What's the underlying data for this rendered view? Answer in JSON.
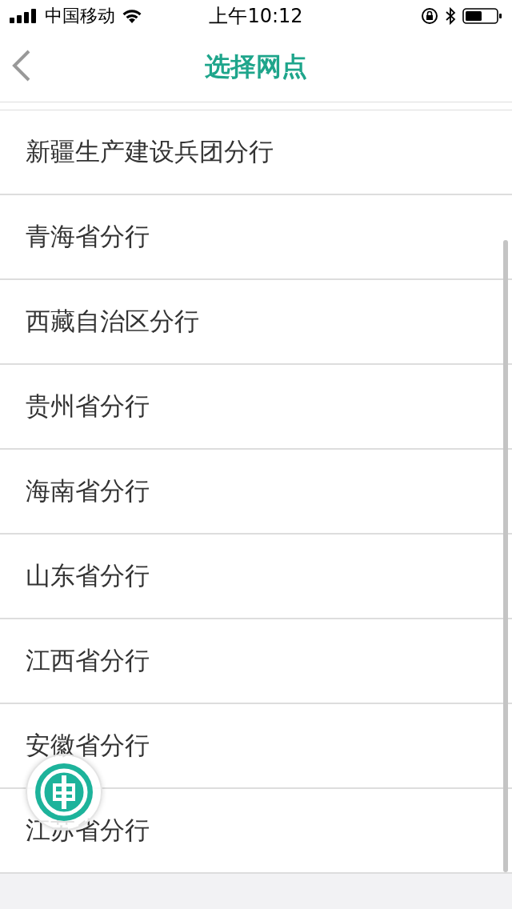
{
  "status_bar": {
    "carrier": "中国移动",
    "time": "上午10:12"
  },
  "nav": {
    "title": "选择网点"
  },
  "branches": [
    {
      "name": "新疆生产建设兵团分行"
    },
    {
      "name": "青海省分行"
    },
    {
      "name": "西藏自治区分行"
    },
    {
      "name": "贵州省分行"
    },
    {
      "name": "海南省分行"
    },
    {
      "name": "山东省分行"
    },
    {
      "name": "江西省分行"
    },
    {
      "name": "安徽省分行"
    },
    {
      "name": "江苏省分行"
    }
  ]
}
